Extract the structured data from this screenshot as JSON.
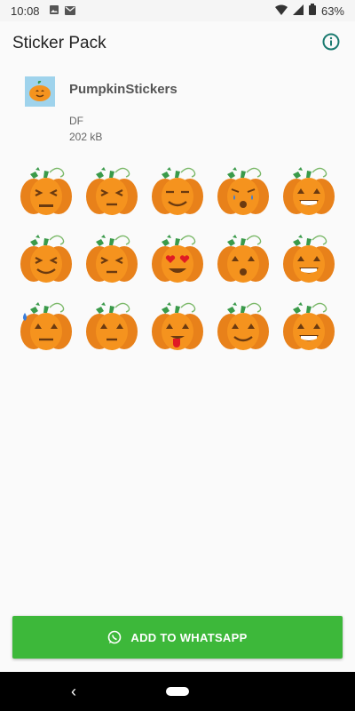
{
  "status_bar": {
    "time": "10:08",
    "battery": "63%"
  },
  "app_bar": {
    "title": "Sticker Pack"
  },
  "pack": {
    "name": "PumpkinStickers",
    "publisher": "DF",
    "size": "202 kB"
  },
  "stickers": [
    {
      "face": "squint-angry"
    },
    {
      "face": "squint-flat"
    },
    {
      "face": "smile-closed"
    },
    {
      "face": "crying"
    },
    {
      "face": "grin-teeth"
    },
    {
      "face": "squint-smile"
    },
    {
      "face": "squint-flat"
    },
    {
      "face": "heart-eyes"
    },
    {
      "face": "shocked"
    },
    {
      "face": "grin-wink"
    },
    {
      "face": "sweat-drop"
    },
    {
      "face": "neutral"
    },
    {
      "face": "tongue-out"
    },
    {
      "face": "smile"
    },
    {
      "face": "grin"
    }
  ],
  "add_button": {
    "label": "ADD TO WHATSAPP"
  },
  "colors": {
    "accent": "#3db83a",
    "pumpkin": "#f5931e",
    "leaf": "#3a9a4a",
    "info": "#1a7a70"
  }
}
